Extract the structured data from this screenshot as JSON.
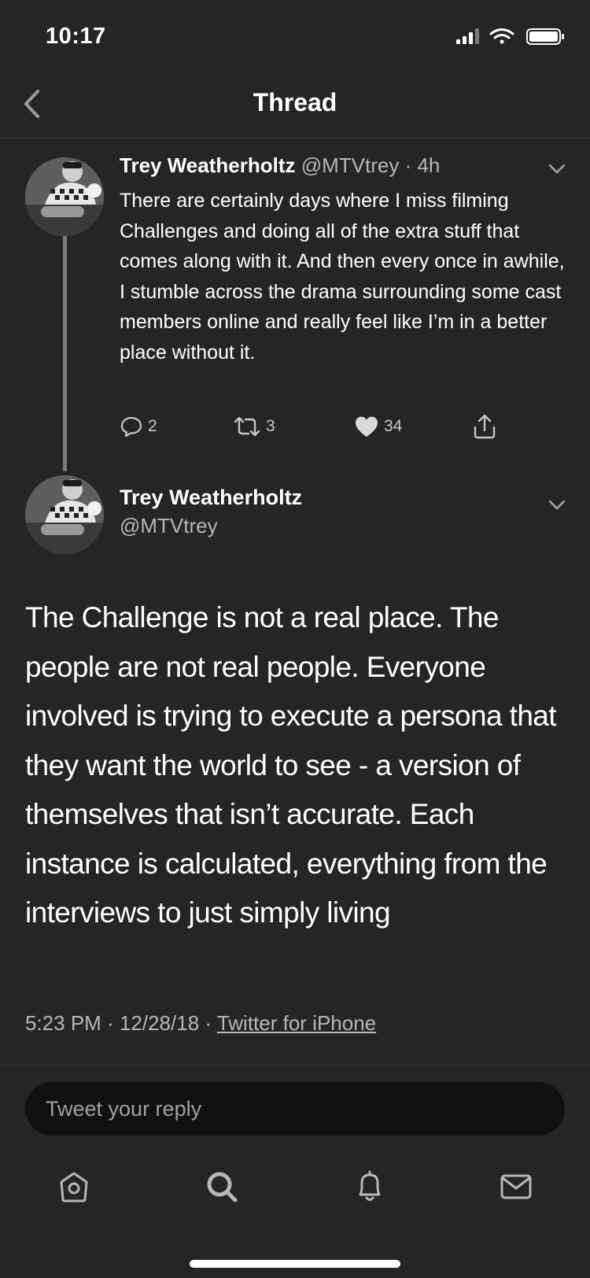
{
  "status_bar": {
    "time": "10:17"
  },
  "header": {
    "title": "Thread",
    "back_icon": "chevron-left-icon"
  },
  "tweets": [
    {
      "display_name": "Trey Weatherholtz",
      "handle": "@MTVtrey",
      "separator": "·",
      "time_ago": "4h",
      "text": "There are certainly days where I miss filming Challenges and doing all of the extra stuff that comes along with it. And then every once in awhile, I stumble across the drama surrounding some cast members online and really feel like I’m in a better place without it.",
      "replies": "2",
      "retweets": "3",
      "likes": "34"
    },
    {
      "display_name": "Trey Weatherholtz",
      "handle": "@MTVtrey",
      "text": "The Challenge is not a real place. The people are not real people. Everyone involved is trying to execute a persona that they want the world to see - a version of themselves that isn’t accurate. Each instance is calculated, everything from the interviews to just simply living",
      "time": "5:23 PM",
      "date": "12/28/18",
      "source": "Twitter for iPhone"
    }
  ],
  "reply": {
    "placeholder": "Tweet your reply"
  },
  "tab_bar": [
    "home-icon",
    "search-icon",
    "notifications-bell-icon",
    "messages-mail-icon"
  ],
  "colors": {
    "background": "#252525",
    "text": "#ffffff",
    "muted": "#b7b7b7",
    "reply_field": "#111111"
  }
}
